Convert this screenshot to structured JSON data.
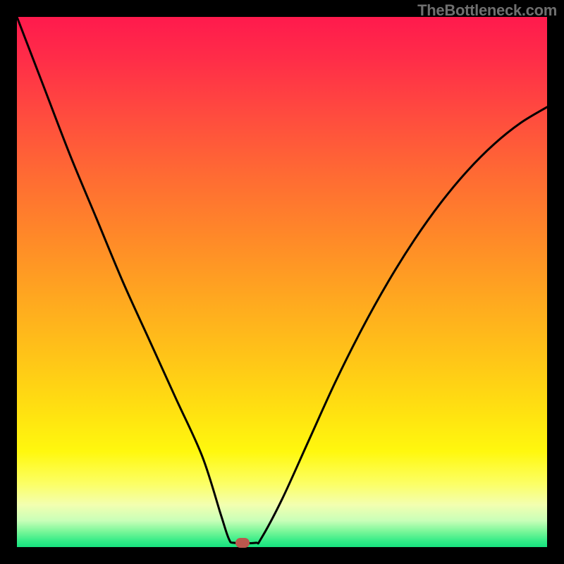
{
  "watermark": "TheBottleneck.com",
  "colors": {
    "frame": "#000000",
    "curve": "#000000",
    "marker": "#bb574d",
    "gradient_top": "#ff1a4d",
    "gradient_bottom": "#17e27f"
  },
  "marker": {
    "x_frac": 0.425,
    "y_frac": 0.992
  },
  "chart_data": {
    "type": "line",
    "title": "",
    "xlabel": "",
    "ylabel": "",
    "xlim": [
      0,
      1
    ],
    "ylim": [
      0,
      1
    ],
    "series": [
      {
        "name": "bottleneck-curve",
        "x": [
          0.0,
          0.05,
          0.1,
          0.15,
          0.2,
          0.25,
          0.3,
          0.35,
          0.385,
          0.4,
          0.41,
          0.45,
          0.46,
          0.5,
          0.55,
          0.6,
          0.65,
          0.7,
          0.75,
          0.8,
          0.85,
          0.9,
          0.95,
          1.0
        ],
        "y": [
          1.0,
          0.87,
          0.74,
          0.62,
          0.5,
          0.39,
          0.28,
          0.17,
          0.06,
          0.015,
          0.008,
          0.008,
          0.015,
          0.09,
          0.2,
          0.31,
          0.41,
          0.5,
          0.58,
          0.65,
          0.71,
          0.76,
          0.8,
          0.83
        ]
      }
    ],
    "annotations": [
      {
        "name": "minimum-marker",
        "x": 0.425,
        "y": 0.008
      }
    ]
  }
}
